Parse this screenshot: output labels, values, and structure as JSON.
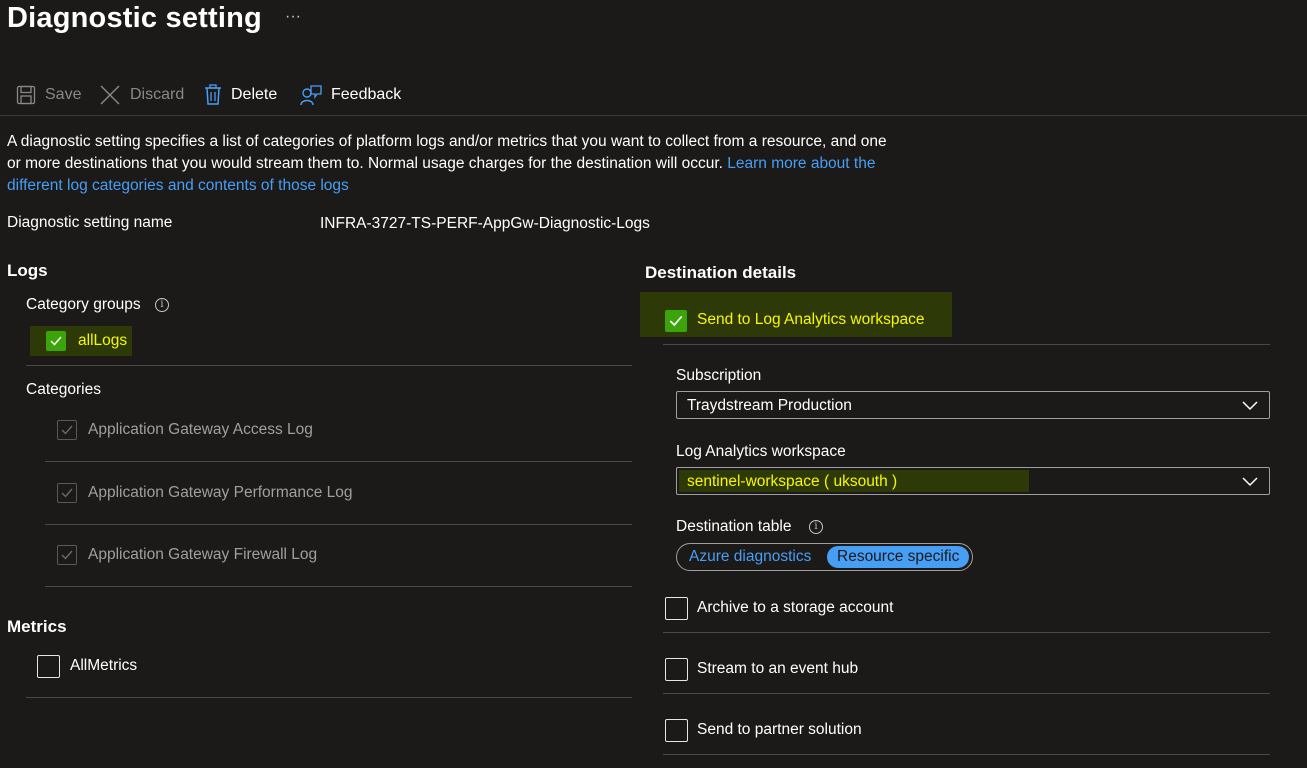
{
  "header": {
    "title": "Diagnostic setting",
    "more_label": "···"
  },
  "toolbar": {
    "save_label": "Save",
    "discard_label": "Discard",
    "delete_label": "Delete",
    "feedback_label": "Feedback"
  },
  "description": {
    "text": "A diagnostic setting specifies a list of categories of platform logs and/or metrics that you want to collect from a resource, and one or more destinations that you would stream them to. Normal usage charges for the destination will occur. ",
    "link": "Learn more about the different log categories and contents of those logs"
  },
  "setting_name": {
    "label": "Diagnostic setting name",
    "value": "INFRA-3727-TS-PERF-AppGw-Diagnostic-Logs"
  },
  "logs": {
    "heading": "Logs",
    "category_groups_label": "Category groups",
    "all_logs_label": "allLogs",
    "categories_label": "Categories",
    "categories": [
      "Application Gateway Access Log",
      "Application Gateway Performance Log",
      "Application Gateway Firewall Log"
    ]
  },
  "metrics": {
    "heading": "Metrics",
    "all_metrics_label": "AllMetrics"
  },
  "destination": {
    "heading": "Destination details",
    "log_analytics_label": "Send to Log Analytics workspace",
    "subscription_label": "Subscription",
    "subscription_value": "Traydstream Production",
    "workspace_label": "Log Analytics workspace",
    "workspace_value": "sentinel-workspace ( uksouth )",
    "table_label": "Destination table",
    "table_options": [
      "Azure diagnostics",
      "Resource specific"
    ],
    "archive_label": "Archive to a storage account",
    "event_hub_label": "Stream to an event hub",
    "partner_label": "Send to partner solution"
  },
  "colors": {
    "background": "#1b1a19",
    "accent": "#479ef5",
    "check": "#3aa40a",
    "highlight": "#f8f800"
  }
}
